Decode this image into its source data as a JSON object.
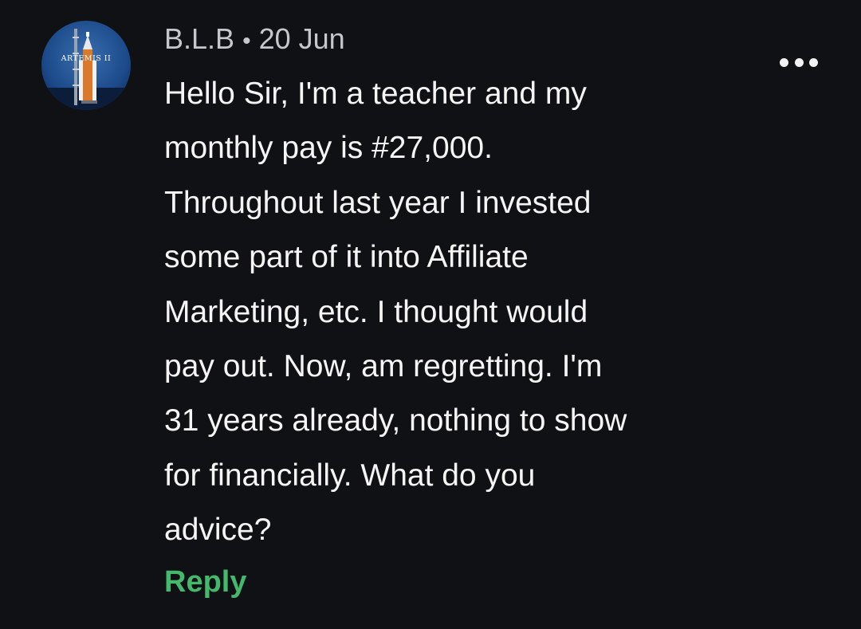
{
  "comment": {
    "author": "B.L.B",
    "separator": "•",
    "date": "20 Jun",
    "avatar": {
      "icon": "artemis-ii-rocket-icon",
      "text": "ARTEMIS II"
    },
    "more_icon": "more-horizontal-icon",
    "body_lines": [
      "Hello Sir, I'm a teacher and my",
      "monthly pay is #27,000.",
      "Throughout last year I invested",
      "some part of it into Affiliate",
      "Marketing, etc. I thought would",
      "pay out. Now, am regretting. I'm",
      "31 years already, nothing to show",
      "for financially. What do you",
      "advice?"
    ],
    "reply_label": "Reply"
  },
  "colors": {
    "background": "#0f1114",
    "text": "#f5f5f5",
    "meta": "#c4c7cc",
    "reply": "#46b86b"
  }
}
